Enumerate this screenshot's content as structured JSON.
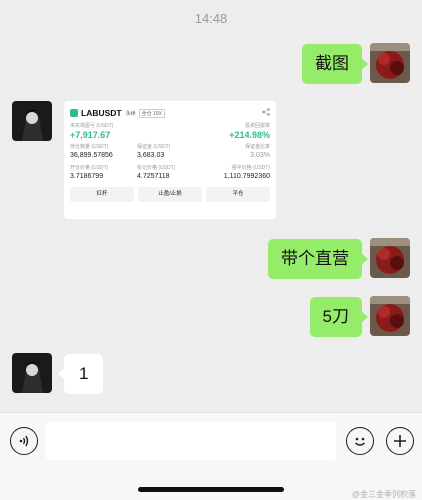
{
  "chat": {
    "timestamp": "14:48",
    "messages": {
      "m1": "截图",
      "m3": "带个直营",
      "m4": "5刀",
      "m5": "1"
    }
  },
  "screenshot_card": {
    "symbol": "LABUSDT",
    "contract_type": "永续",
    "margin_mode": "全仓 10X",
    "unrealized_pnl_label": "未实现盈亏 (USDT)",
    "unrealized_pnl_value": "+7,917.67",
    "roi_label": "投资回报率",
    "roi_value": "+214.98%",
    "position_size_label": "持仓数量 (USDT)",
    "position_size_value": "36,899.57856",
    "margin_label": "保证金 (USDT)",
    "margin_value": "3,683.03",
    "margin_ratio_label": "保证金比率",
    "margin_ratio_value": "3.03%",
    "entry_price_label": "开仓价格 (USDT)",
    "entry_price_value": "3.7186799",
    "mark_price_label": "标记价格 (USDT)",
    "mark_price_value": "4.7257118",
    "liq_price_label": "强平价格 (USDT)",
    "liq_price_value": "1,110.7992360",
    "buttons": {
      "leverage": "杠杆",
      "tp_sl": "止盈/止损",
      "close": "平仓"
    }
  },
  "input_bar": {
    "watermark": "@金三金季列积落"
  },
  "colors": {
    "bubble_me": "#95ec69",
    "bubble_other": "#ffffff",
    "background": "#ededed",
    "profit_green": "#2ebd85"
  }
}
